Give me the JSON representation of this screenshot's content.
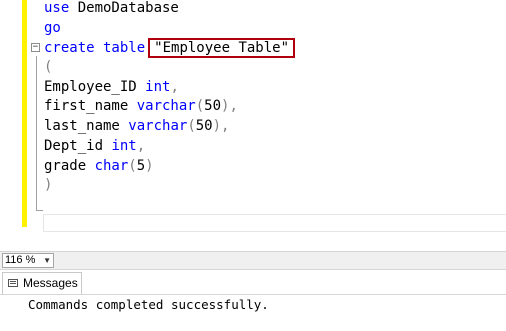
{
  "editor": {
    "lines": [
      {
        "parts": [
          {
            "t": "use ",
            "c": "kw"
          },
          {
            "t": "DemoDatabase",
            "c": ""
          }
        ]
      },
      {
        "parts": [
          {
            "t": "go",
            "c": "kw"
          }
        ]
      },
      {
        "parts": [
          {
            "t": "create table",
            "c": "kw"
          }
        ],
        "highlight": "\"Employee Table\""
      },
      {
        "parts": [
          {
            "t": "(",
            "c": "gray"
          }
        ]
      },
      {
        "parts": [
          {
            "t": "Employee_ID ",
            "c": ""
          },
          {
            "t": "int",
            "c": "kw"
          },
          {
            "t": ",",
            "c": "gray"
          }
        ]
      },
      {
        "parts": [
          {
            "t": "first_name ",
            "c": ""
          },
          {
            "t": "varchar",
            "c": "kw"
          },
          {
            "t": "(",
            "c": "gray"
          },
          {
            "t": "50",
            "c": ""
          },
          {
            "t": "),",
            "c": "gray"
          }
        ]
      },
      {
        "parts": [
          {
            "t": "last_name ",
            "c": ""
          },
          {
            "t": "varchar",
            "c": "kw"
          },
          {
            "t": "(",
            "c": "gray"
          },
          {
            "t": "50",
            "c": ""
          },
          {
            "t": "),",
            "c": "gray"
          }
        ]
      },
      {
        "parts": [
          {
            "t": "Dept_id ",
            "c": ""
          },
          {
            "t": "int",
            "c": "kw"
          },
          {
            "t": ",",
            "c": "gray"
          }
        ]
      },
      {
        "parts": [
          {
            "t": "grade ",
            "c": ""
          },
          {
            "t": "char",
            "c": "kw"
          },
          {
            "t": "(",
            "c": "gray"
          },
          {
            "t": "5",
            "c": ""
          },
          {
            "t": ")",
            "c": "gray"
          }
        ]
      },
      {
        "parts": [
          {
            "t": ")",
            "c": "gray"
          }
        ]
      }
    ]
  },
  "status": {
    "zoom": "116 %"
  },
  "results": {
    "tab_label": "Messages",
    "message": "Commands completed successfully."
  },
  "colors": {
    "keyword": "#0000ff",
    "string": "#a31515",
    "operator": "#808080",
    "change_bar": "#fff200",
    "highlight_border": "#b0000e"
  }
}
